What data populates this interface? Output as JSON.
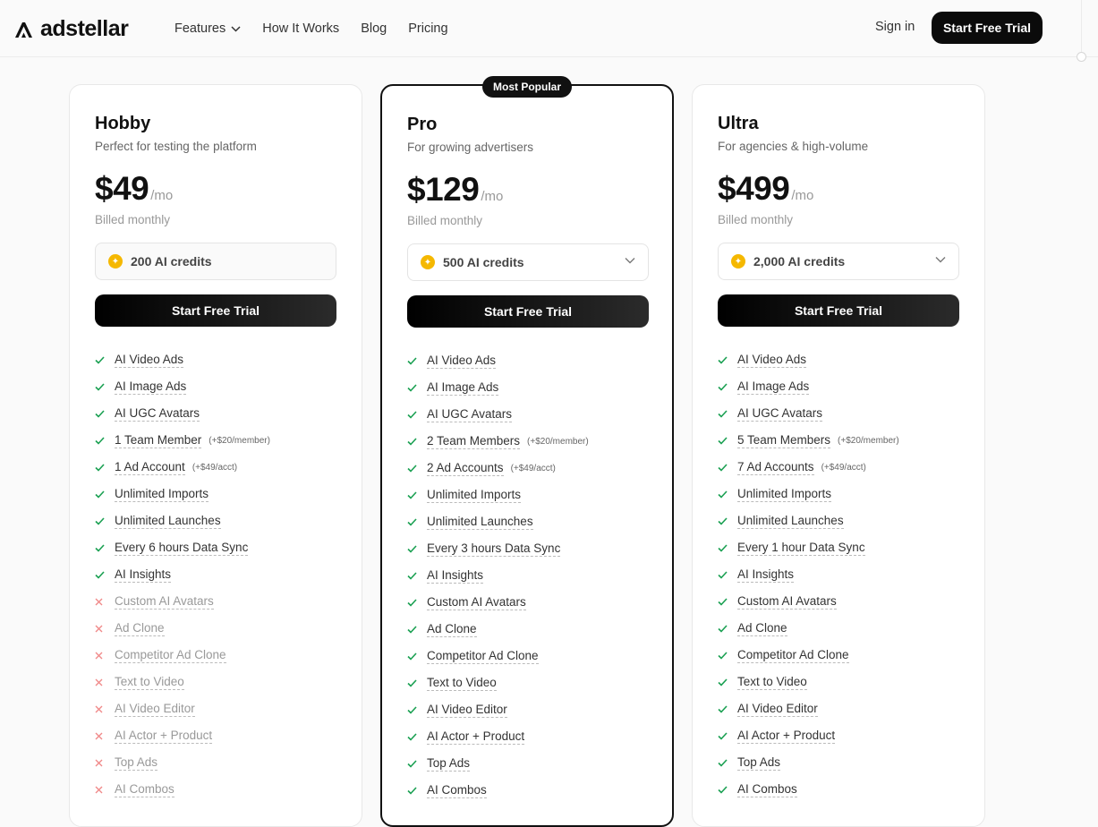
{
  "header": {
    "logo_text": "adstellar",
    "nav": [
      "Features",
      "How It Works",
      "Blog",
      "Pricing"
    ],
    "sign_in": "Sign in",
    "cta": "Start Free Trial"
  },
  "plans": [
    {
      "name": "Hobby",
      "description": "Perfect for testing the platform",
      "price": "$49",
      "period": "/mo",
      "billing": "Billed monthly",
      "credits": "200 AI credits",
      "credits_dropdown": false,
      "cta": "Start Free Trial",
      "popular": false,
      "features": [
        {
          "label": "AI Video Ads",
          "included": true,
          "note": ""
        },
        {
          "label": "AI Image Ads",
          "included": true,
          "note": ""
        },
        {
          "label": "AI UGC Avatars",
          "included": true,
          "note": ""
        },
        {
          "label": "1 Team Member",
          "included": true,
          "note": "(+$20/member)"
        },
        {
          "label": "1 Ad Account",
          "included": true,
          "note": "(+$49/acct)"
        },
        {
          "label": "Unlimited Imports",
          "included": true,
          "note": ""
        },
        {
          "label": "Unlimited Launches",
          "included": true,
          "note": ""
        },
        {
          "label": "Every 6 hours Data Sync",
          "included": true,
          "note": ""
        },
        {
          "label": "AI Insights",
          "included": true,
          "note": ""
        },
        {
          "label": "Custom AI Avatars",
          "included": false,
          "note": ""
        },
        {
          "label": "Ad Clone",
          "included": false,
          "note": ""
        },
        {
          "label": "Competitor Ad Clone",
          "included": false,
          "note": ""
        },
        {
          "label": "Text to Video",
          "included": false,
          "note": ""
        },
        {
          "label": "AI Video Editor",
          "included": false,
          "note": ""
        },
        {
          "label": "AI Actor + Product",
          "included": false,
          "note": ""
        },
        {
          "label": "Top Ads",
          "included": false,
          "note": ""
        },
        {
          "label": "AI Combos",
          "included": false,
          "note": ""
        }
      ]
    },
    {
      "name": "Pro",
      "description": "For growing advertisers",
      "price": "$129",
      "period": "/mo",
      "billing": "Billed monthly",
      "credits": "500 AI credits",
      "credits_dropdown": true,
      "cta": "Start Free Trial",
      "popular": true,
      "badge": "Most Popular",
      "features": [
        {
          "label": "AI Video Ads",
          "included": true,
          "note": ""
        },
        {
          "label": "AI Image Ads",
          "included": true,
          "note": ""
        },
        {
          "label": "AI UGC Avatars",
          "included": true,
          "note": ""
        },
        {
          "label": "2 Team Members",
          "included": true,
          "note": "(+$20/member)"
        },
        {
          "label": "2 Ad Accounts",
          "included": true,
          "note": "(+$49/acct)"
        },
        {
          "label": "Unlimited Imports",
          "included": true,
          "note": ""
        },
        {
          "label": "Unlimited Launches",
          "included": true,
          "note": ""
        },
        {
          "label": "Every 3 hours Data Sync",
          "included": true,
          "note": ""
        },
        {
          "label": "AI Insights",
          "included": true,
          "note": ""
        },
        {
          "label": "Custom AI Avatars",
          "included": true,
          "note": ""
        },
        {
          "label": "Ad Clone",
          "included": true,
          "note": ""
        },
        {
          "label": "Competitor Ad Clone",
          "included": true,
          "note": ""
        },
        {
          "label": "Text to Video",
          "included": true,
          "note": ""
        },
        {
          "label": "AI Video Editor",
          "included": true,
          "note": ""
        },
        {
          "label": "AI Actor + Product",
          "included": true,
          "note": ""
        },
        {
          "label": "Top Ads",
          "included": true,
          "note": ""
        },
        {
          "label": "AI Combos",
          "included": true,
          "note": ""
        }
      ]
    },
    {
      "name": "Ultra",
      "description": "For agencies & high-volume",
      "price": "$499",
      "period": "/mo",
      "billing": "Billed monthly",
      "credits": "2,000 AI credits",
      "credits_dropdown": true,
      "cta": "Start Free Trial",
      "popular": false,
      "features": [
        {
          "label": "AI Video Ads",
          "included": true,
          "note": ""
        },
        {
          "label": "AI Image Ads",
          "included": true,
          "note": ""
        },
        {
          "label": "AI UGC Avatars",
          "included": true,
          "note": ""
        },
        {
          "label": "5 Team Members",
          "included": true,
          "note": "(+$20/member)"
        },
        {
          "label": "7 Ad Accounts",
          "included": true,
          "note": "(+$49/acct)"
        },
        {
          "label": "Unlimited Imports",
          "included": true,
          "note": ""
        },
        {
          "label": "Unlimited Launches",
          "included": true,
          "note": ""
        },
        {
          "label": "Every 1 hour Data Sync",
          "included": true,
          "note": ""
        },
        {
          "label": "AI Insights",
          "included": true,
          "note": ""
        },
        {
          "label": "Custom AI Avatars",
          "included": true,
          "note": ""
        },
        {
          "label": "Ad Clone",
          "included": true,
          "note": ""
        },
        {
          "label": "Competitor Ad Clone",
          "included": true,
          "note": ""
        },
        {
          "label": "Text to Video",
          "included": true,
          "note": ""
        },
        {
          "label": "AI Video Editor",
          "included": true,
          "note": ""
        },
        {
          "label": "AI Actor + Product",
          "included": true,
          "note": ""
        },
        {
          "label": "Top Ads",
          "included": true,
          "note": ""
        },
        {
          "label": "AI Combos",
          "included": true,
          "note": ""
        }
      ]
    }
  ],
  "colors": {
    "check": "#1aa052",
    "cross": "#f08a8a",
    "coin": "#f5b800",
    "primary": "#0b0b0b"
  }
}
